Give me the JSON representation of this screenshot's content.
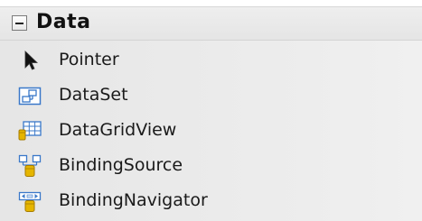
{
  "toolbox": {
    "group": {
      "title": "Data",
      "expanded": true,
      "items": [
        {
          "label": "Pointer",
          "icon": "pointer-arrow-icon"
        },
        {
          "label": "DataSet",
          "icon": "dataset-icon"
        },
        {
          "label": "DataGridView",
          "icon": "datagridview-icon"
        },
        {
          "label": "BindingSource",
          "icon": "bindingsource-icon"
        },
        {
          "label": "BindingNavigator",
          "icon": "bindingnavigator-icon"
        }
      ]
    }
  },
  "colors": {
    "header_bg": "#e9e9e9",
    "items_bg": "#ececec",
    "text": "#1a1a1a",
    "icon_blue": "#3a78c9",
    "icon_gold": "#e5b500"
  }
}
